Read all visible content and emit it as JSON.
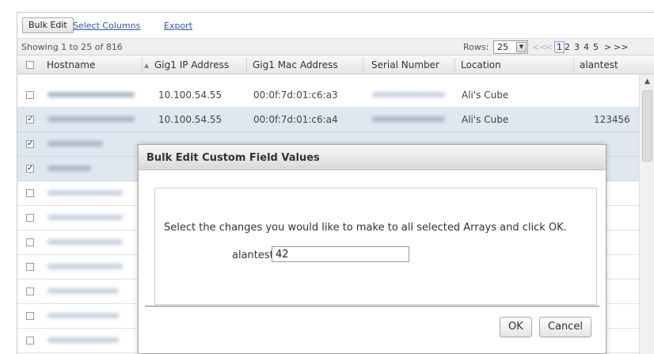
{
  "toolbar": {
    "bulk_edit": "Bulk Edit",
    "select_columns": "Select Columns",
    "export": "Export"
  },
  "info": {
    "showing": "Showing 1 to 25 of 816",
    "rows_label": "Rows:",
    "rows_value": "25",
    "pager": {
      "first": "<<",
      "prev": "<",
      "pages": [
        "1",
        "2",
        "3",
        "4",
        "5"
      ],
      "next": ">",
      "last": ">>"
    }
  },
  "columns": {
    "hostname": "Hostname",
    "gig1_ip": "Gig1 IP Address",
    "gig1_mac": "Gig1 Mac Address",
    "serial": "Serial Number",
    "location": "Location",
    "custom": "alantest"
  },
  "rows": [
    {
      "ip": "10.100.54.55",
      "mac": "00:0f:7d:01:c6:a3",
      "location": "Ali's Cube",
      "alantest": "",
      "checked": false
    },
    {
      "ip": "10.100.54.55",
      "mac": "00:0f:7d:01:c6:a4",
      "location": "Ali's Cube",
      "alantest": "123456",
      "checked": true
    }
  ],
  "check_mark": "✓",
  "dialog": {
    "title": "Bulk Edit Custom Field Values",
    "message": "Select the changes you would like to make to all selected Arrays and click OK.",
    "field_label": "alantest",
    "field_value": "42",
    "ok": "OK",
    "cancel": "Cancel"
  },
  "colors": {
    "selected_row": "#dfe7f1",
    "link": "#2a5aa8"
  }
}
